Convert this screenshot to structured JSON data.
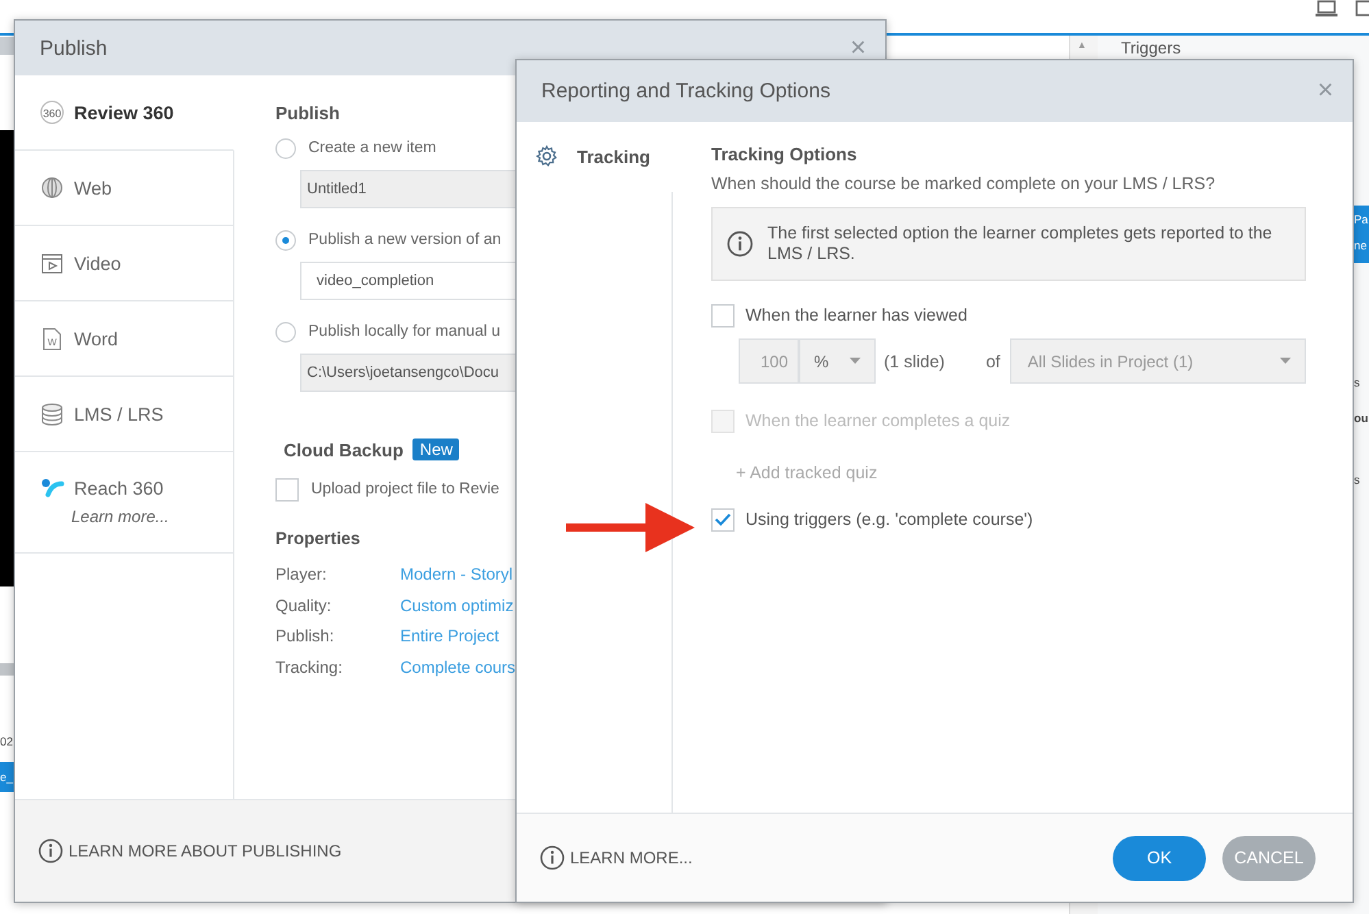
{
  "background_app": {
    "panel_title": "Triggers",
    "scroll_up_glyph": "▲",
    "fragments": [
      {
        "text": "02",
        "kind": "plain"
      },
      {
        "text": "e_",
        "kind": "highlighted"
      },
      {
        "text": "Pa",
        "kind": "highlighted"
      },
      {
        "text": "ne",
        "kind": "highlighted"
      },
      {
        "text": "s",
        "kind": "plain"
      },
      {
        "text": "ou",
        "kind": "bold"
      },
      {
        "text": "s",
        "kind": "plain"
      }
    ]
  },
  "publish_window": {
    "title": "Publish",
    "close_glyph": "×",
    "sidebar": {
      "items": [
        {
          "label": "Review 360",
          "kind": "review",
          "icon_text": "360",
          "selected": true
        },
        {
          "label": "Web",
          "kind": "web",
          "selected": false
        },
        {
          "label": "Video",
          "kind": "video",
          "selected": false
        },
        {
          "label": "Word",
          "kind": "word",
          "icon_text": "W",
          "selected": false
        },
        {
          "label": "LMS / LRS",
          "kind": "lms",
          "selected": false
        },
        {
          "label": "Reach 360",
          "kind": "reach",
          "sublabel": "Learn more...",
          "selected": false
        }
      ]
    },
    "publish_heading": "Publish",
    "publish_options": [
      {
        "label": "Create a new item",
        "selected": false,
        "field": {
          "value": "Untitled1",
          "disabled": true
        }
      },
      {
        "label": "Publish a new version of an",
        "selected": true,
        "field": {
          "value": "video_completion",
          "disabled": false
        }
      },
      {
        "label": "Publish locally for manual u",
        "selected": false,
        "field": {
          "value": "C:\\Users\\joetansengco\\Docu",
          "disabled": true
        }
      }
    ],
    "cloud_backup": {
      "heading": "Cloud Backup",
      "badge": "New",
      "checkbox": {
        "label": "Upload project file to Revie",
        "checked": false
      }
    },
    "properties": {
      "heading": "Properties",
      "rows": [
        {
          "label": "Player:",
          "value": "Modern - Storyl"
        },
        {
          "label": "Quality:",
          "value": "Custom optimiz"
        },
        {
          "label": "Publish:",
          "value": "Entire Project"
        },
        {
          "label": "Tracking:",
          "value": "Complete cours"
        }
      ]
    },
    "footer_link": "LEARN MORE ABOUT PUBLISHING"
  },
  "tracking_dialog": {
    "title": "Reporting and Tracking Options",
    "close_glyph": "×",
    "nav": [
      {
        "label": "Tracking",
        "selected": true
      }
    ],
    "heading": "Tracking Options",
    "question": "When should the course be marked complete on your LMS / LRS?",
    "info_note": "The first selected option the learner completes gets reported to the LMS / LRS.",
    "options": [
      {
        "kind": "viewed",
        "label": "When the learner has viewed",
        "checked": false,
        "disabled": false
      },
      {
        "kind": "quiz",
        "label": "When the learner completes a quiz",
        "checked": false,
        "disabled": true
      },
      {
        "kind": "triggers",
        "label": "Using triggers (e.g. 'complete course')",
        "checked": true,
        "disabled": false
      }
    ],
    "viewed_controls": {
      "amount": "100",
      "unit": "%",
      "slide_count": "(1 slide)",
      "of_label": "of",
      "scope": "All Slides in Project (1)",
      "disabled": true
    },
    "add_quiz_link": "+ Add tracked quiz",
    "footer_link": "LEARN MORE...",
    "buttons": [
      {
        "label": "OK",
        "kind": "primary"
      },
      {
        "label": "CANCEL",
        "kind": "secondary"
      }
    ]
  }
}
